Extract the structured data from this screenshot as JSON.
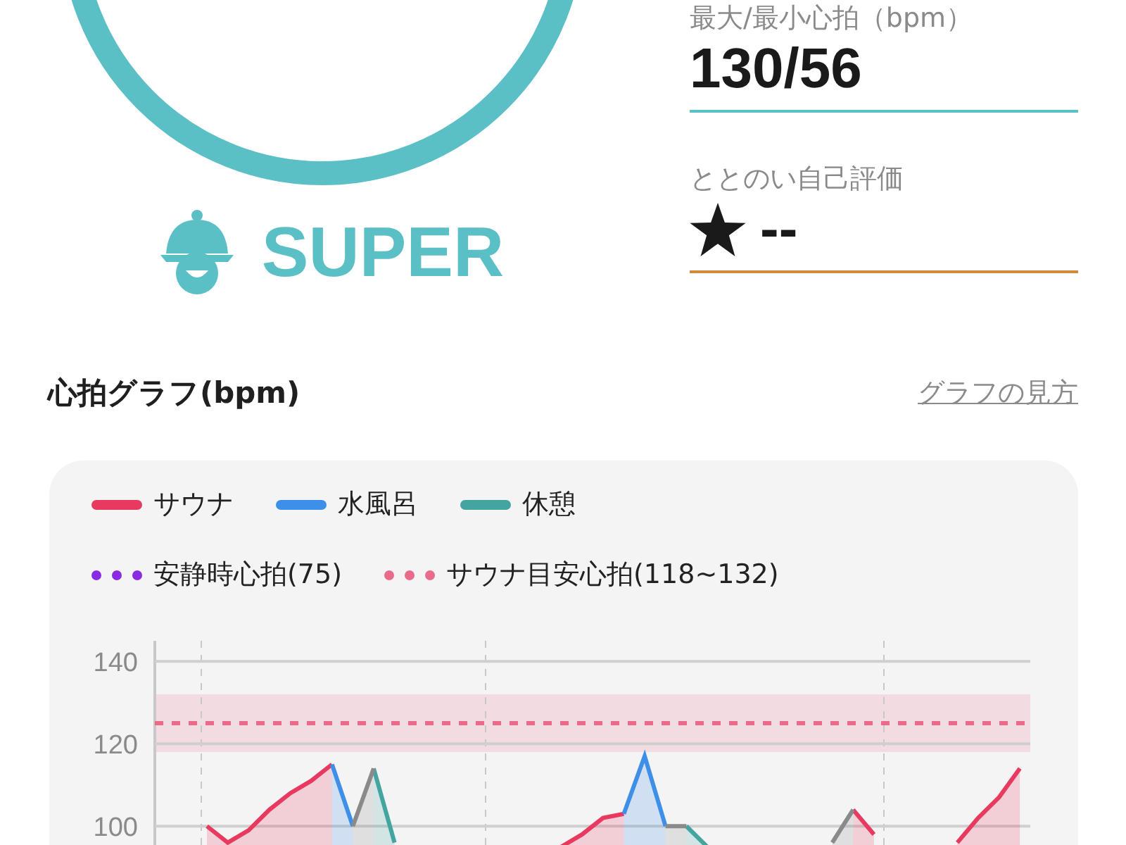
{
  "summary": {
    "level_text": "SUPER",
    "stats": [
      {
        "label": "最大/最小心拍（bpm）",
        "value": "130/56",
        "color": "#5bbfc6",
        "kind": "text"
      },
      {
        "label": "ととのい自己評価",
        "value": "--",
        "color": "#d08a3c",
        "kind": "rating"
      }
    ]
  },
  "section": {
    "title": "心拍グラフ(bpm)",
    "link": "グラフの見方"
  },
  "reference_legend": [
    {
      "label": "安静時心拍(75)",
      "color": "#8a2be2"
    },
    {
      "label": "サウナ目安心拍(118~132)",
      "color": "#ea6a8c"
    }
  ],
  "chart_data": {
    "type": "area",
    "ylim": [
      94,
      145
    ],
    "yticks": [
      100,
      120,
      140
    ],
    "grid": true,
    "series": [
      {
        "name": "サウナ",
        "color": "#e8395f",
        "values": [
          null,
          null,
          100,
          96,
          99,
          104,
          108,
          111,
          115,
          null,
          null,
          null,
          null,
          null,
          null,
          null,
          null,
          null,
          null,
          95,
          98,
          102,
          103,
          null,
          null,
          null,
          null,
          null,
          null,
          null,
          null,
          null,
          null,
          104,
          98,
          null,
          null,
          null,
          96,
          102,
          107,
          114
        ]
      },
      {
        "name": "水風呂",
        "color": "#3d8fe8",
        "values": [
          null,
          null,
          null,
          null,
          null,
          null,
          null,
          null,
          115,
          100,
          null,
          null,
          null,
          null,
          null,
          null,
          null,
          null,
          null,
          null,
          null,
          null,
          103,
          117,
          100,
          null,
          null,
          null,
          null,
          null,
          null,
          null,
          null,
          null,
          null,
          null,
          null,
          null,
          null,
          null,
          null,
          null
        ]
      },
      {
        "name": "休憩",
        "color": "#44a5a0",
        "values": [
          null,
          null,
          null,
          null,
          null,
          null,
          null,
          null,
          null,
          null,
          114,
          96,
          null,
          null,
          null,
          null,
          null,
          null,
          null,
          null,
          null,
          null,
          null,
          null,
          null,
          100,
          95,
          null,
          null,
          null,
          null,
          null,
          null,
          null,
          null,
          null,
          null,
          null,
          null,
          null,
          null,
          null
        ]
      },
      {
        "color": "#8a8a8a",
        "values": [
          null,
          null,
          null,
          null,
          null,
          null,
          null,
          null,
          null,
          100,
          114,
          null,
          null,
          null,
          null,
          null,
          null,
          null,
          null,
          null,
          null,
          null,
          null,
          null,
          100,
          100,
          null,
          null,
          null,
          null,
          null,
          null,
          96,
          104,
          null,
          null,
          null,
          null,
          null,
          null,
          null,
          null
        ]
      }
    ],
    "bands": [
      {
        "axis": "y",
        "from": 118,
        "to": 132,
        "color": "#ea6a8c"
      }
    ],
    "ref_lines": [
      {
        "axis": "y",
        "value": 125,
        "color": "#ea6a8c"
      }
    ]
  }
}
